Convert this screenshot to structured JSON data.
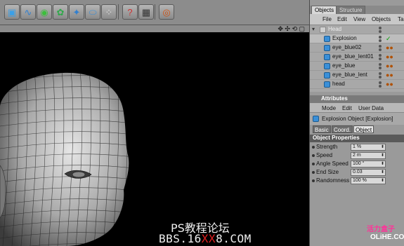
{
  "toolbar": {
    "buttons": [
      {
        "name": "cube-primitive-icon",
        "glyph": "▣",
        "color": "#3aa0e8"
      },
      {
        "name": "spline-icon",
        "glyph": "∿",
        "color": "#2f7fd0"
      },
      {
        "name": "nurbs-icon",
        "glyph": "◉",
        "color": "#3cbf3c"
      },
      {
        "name": "array-icon",
        "glyph": "✿",
        "color": "#2fa84a"
      },
      {
        "name": "deformer-icon",
        "glyph": "✦",
        "color": "#2f7fd0"
      },
      {
        "name": "environment-icon",
        "glyph": "⬭",
        "color": "#3a8fd8"
      },
      {
        "name": "particles-icon",
        "glyph": "⁘",
        "color": "#e0e0e0"
      },
      {
        "name": "help-cursor-icon",
        "glyph": "?",
        "color": "#d03030"
      },
      {
        "name": "render-settings-icon",
        "glyph": "▦",
        "color": "#333333"
      },
      {
        "name": "render-icon",
        "glyph": "◎",
        "color": "#d05010"
      }
    ]
  },
  "viewport": {
    "nav_icons": "✥ ✣ ⟲ ▢",
    "watermark_line1": "PS教程论坛",
    "watermark_line2_prefix": "BBS.16",
    "watermark_line2_red": "XX",
    "watermark_line2_suffix": "8.COM"
  },
  "objects_panel": {
    "tabs": [
      "Objects",
      "Structure"
    ],
    "menu": [
      "File",
      "Edit",
      "View",
      "Objects",
      "Ta"
    ],
    "tree": [
      {
        "label": "Head",
        "type": "null",
        "indent": 14,
        "dim": true,
        "tag": ""
      },
      {
        "label": "Explosion",
        "type": "deformer",
        "indent": 20,
        "dim": false,
        "tag": "✓",
        "selected": true
      },
      {
        "label": "eye_blue02",
        "type": "mesh",
        "indent": 20,
        "dim": false,
        "tag": "●●"
      },
      {
        "label": "eye_blue_lent01",
        "type": "mesh",
        "indent": 20,
        "dim": false,
        "tag": "●●"
      },
      {
        "label": "eye_blue",
        "type": "mesh",
        "indent": 20,
        "dim": false,
        "tag": "●●"
      },
      {
        "label": "eye_blue_lent",
        "type": "mesh",
        "indent": 20,
        "dim": false,
        "tag": "●●"
      },
      {
        "label": "head",
        "type": "mesh",
        "indent": 20,
        "dim": false,
        "tag": "●●"
      }
    ]
  },
  "attributes": {
    "title": "Attributes",
    "menu": [
      "Mode",
      "Edit",
      "User Data"
    ],
    "object_label": "Explosion Object [Explosion]",
    "tabs": [
      "Basic",
      "Coord.",
      "Object"
    ],
    "active_tab": "Object",
    "section_title": "Object Properties",
    "properties": [
      {
        "label": "Strength",
        "value": "1 %"
      },
      {
        "label": "Speed",
        "value": "2 m"
      },
      {
        "label": "Angle Speed",
        "value": "100 °"
      },
      {
        "label": "End Size",
        "value": "0.03"
      },
      {
        "label": "Randomness",
        "value": "100 %"
      }
    ]
  },
  "corner_watermark": {
    "cn": "活力盒子",
    "en": "OLiHE.COM"
  },
  "colors": {
    "viewport_bg": "#000000",
    "panel_bg": "#9a9a9a",
    "accent_blue": "#3a8fd8",
    "watermark_red": "#e02020",
    "watermark_pink": "#ff3399"
  }
}
